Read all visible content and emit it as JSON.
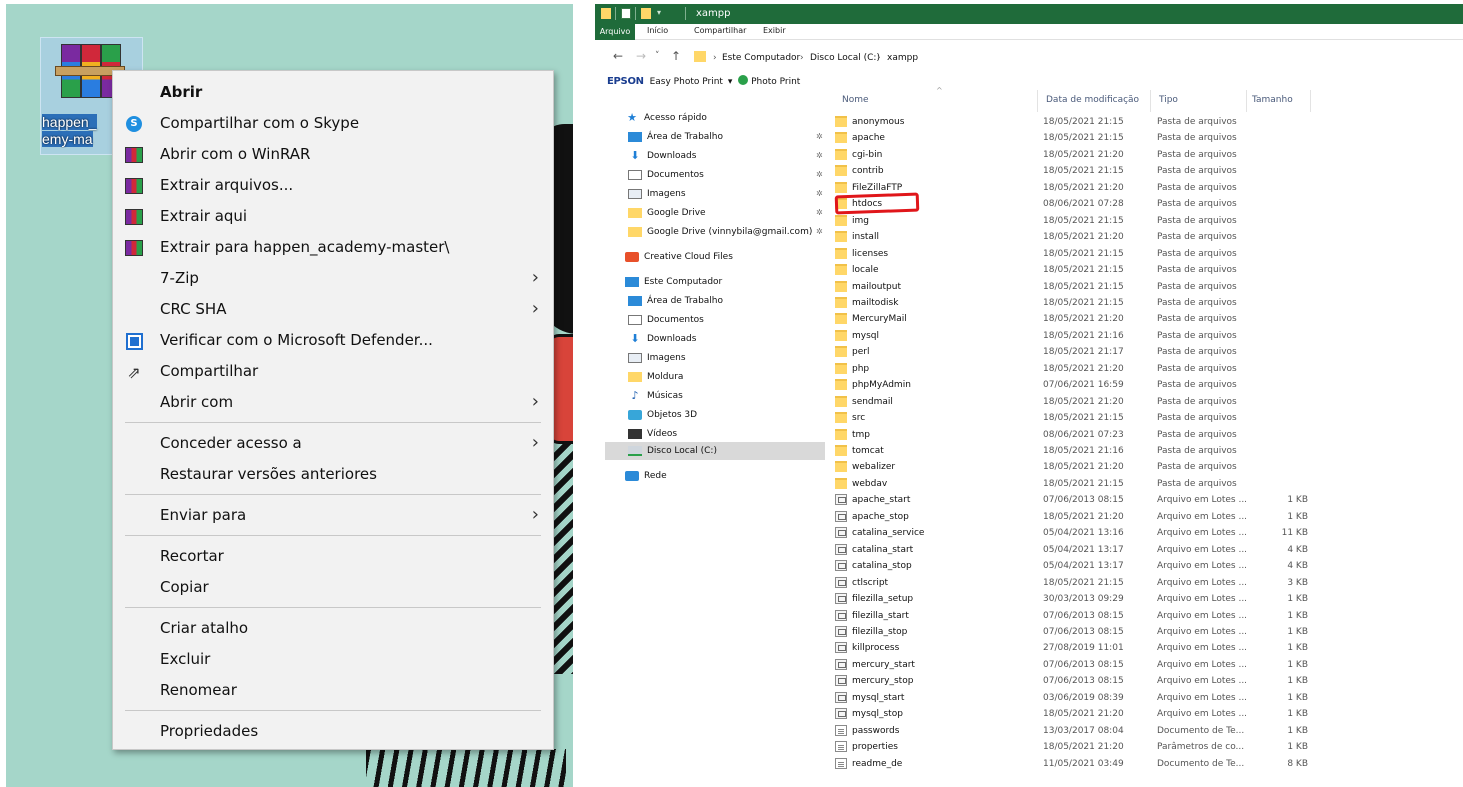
{
  "desktop": {
    "file_icon": {
      "name_line1": "happen_",
      "name_line2": "emy-ma",
      "icon": "winrar-archive-icon"
    }
  },
  "context_menu": {
    "items": [
      {
        "label": "Abrir",
        "bold": true,
        "icon": "",
        "submenu": false
      },
      {
        "label": "Compartilhar com o Skype",
        "icon": "skype-icon",
        "submenu": false
      },
      {
        "label": "Abrir com o WinRAR",
        "icon": "winrar-icon",
        "submenu": false
      },
      {
        "label": "Extrair arquivos...",
        "icon": "winrar-icon",
        "submenu": false
      },
      {
        "label": "Extrair aqui",
        "icon": "winrar-icon",
        "submenu": false
      },
      {
        "label": "Extrair para happen_academy-master\\",
        "icon": "winrar-icon",
        "submenu": false
      },
      {
        "label": "7-Zip",
        "icon": "",
        "submenu": true
      },
      {
        "label": "CRC SHA",
        "icon": "",
        "submenu": true
      },
      {
        "label": "Verificar com o Microsoft Defender...",
        "icon": "defender-icon",
        "submenu": false
      },
      {
        "label": "Compartilhar",
        "icon": "share-icon",
        "submenu": false
      },
      {
        "label": "Abrir com",
        "icon": "",
        "submenu": true
      },
      {
        "separator": true
      },
      {
        "label": "Conceder acesso a",
        "icon": "",
        "submenu": true
      },
      {
        "label": "Restaurar versões anteriores",
        "icon": "",
        "submenu": false
      },
      {
        "separator": true
      },
      {
        "label": "Enviar para",
        "icon": "",
        "submenu": true
      },
      {
        "separator": true
      },
      {
        "label": "Recortar",
        "icon": "",
        "submenu": false
      },
      {
        "label": "Copiar",
        "icon": "",
        "submenu": false
      },
      {
        "separator": true
      },
      {
        "label": "Criar atalho",
        "icon": "",
        "submenu": false
      },
      {
        "label": "Excluir",
        "icon": "",
        "submenu": false
      },
      {
        "label": "Renomear",
        "icon": "",
        "submenu": false
      },
      {
        "separator": true
      },
      {
        "label": "Propriedades",
        "icon": "",
        "submenu": false
      }
    ]
  },
  "explorer": {
    "window_title": "xampp",
    "ribbon_tabs": [
      "Arquivo",
      "Início",
      "Compartilhar",
      "Exibir"
    ],
    "address": {
      "segments": [
        "Este Computador",
        "Disco Local (C:)",
        "xampp"
      ],
      "separator": ">"
    },
    "epson": {
      "logo": "EPSON",
      "easy_photo_print": "Easy Photo Print",
      "dropdown": "▾",
      "photo_print": "Photo Print"
    },
    "nav": [
      {
        "label": "Acesso rápido",
        "icon": "star-icon",
        "level": 0,
        "pin": false
      },
      {
        "label": "Área de Trabalho",
        "icon": "desktop-icon",
        "level": 1,
        "pin": true
      },
      {
        "label": "Downloads",
        "icon": "download-icon",
        "level": 1,
        "pin": true
      },
      {
        "label": "Documentos",
        "icon": "documents-icon",
        "level": 1,
        "pin": true
      },
      {
        "label": "Imagens",
        "icon": "images-icon",
        "level": 1,
        "pin": true
      },
      {
        "label": "Google Drive",
        "icon": "folder-icon",
        "level": 1,
        "pin": true
      },
      {
        "label": "Google Drive (vinnybila@gmail.com)",
        "icon": "folder-icon",
        "level": 1,
        "pin": true
      },
      {
        "label": "Creative Cloud Files",
        "icon": "creative-cloud-icon",
        "level": 0,
        "pin": false
      },
      {
        "label": "Este Computador",
        "icon": "computer-icon",
        "level": 0,
        "pin": false
      },
      {
        "label": "Área de Trabalho",
        "icon": "desktop-icon",
        "level": 1,
        "pin": false
      },
      {
        "label": "Documentos",
        "icon": "documents-icon",
        "level": 1,
        "pin": false
      },
      {
        "label": "Downloads",
        "icon": "download-icon",
        "level": 1,
        "pin": false
      },
      {
        "label": "Imagens",
        "icon": "images-icon",
        "level": 1,
        "pin": false
      },
      {
        "label": "Moldura",
        "icon": "folder-icon",
        "level": 1,
        "pin": false
      },
      {
        "label": "Músicas",
        "icon": "music-icon",
        "level": 1,
        "pin": false
      },
      {
        "label": "Objetos 3D",
        "icon": "3d-objects-icon",
        "level": 1,
        "pin": false
      },
      {
        "label": "Vídeos",
        "icon": "videos-icon",
        "level": 1,
        "pin": false
      },
      {
        "label": "Disco Local (C:)",
        "icon": "drive-icon",
        "level": 1,
        "pin": false,
        "selected": true
      },
      {
        "label": "Rede",
        "icon": "network-icon",
        "level": 0,
        "pin": false
      }
    ],
    "columns": [
      "Nome",
      "Data de modificação",
      "Tipo",
      "Tamanho"
    ],
    "files": [
      {
        "name": "anonymous",
        "date": "18/05/2021 21:15",
        "type": "Pasta de arquivos",
        "size": "",
        "kind": "folder"
      },
      {
        "name": "apache",
        "date": "18/05/2021 21:15",
        "type": "Pasta de arquivos",
        "size": "",
        "kind": "folder"
      },
      {
        "name": "cgi-bin",
        "date": "18/05/2021 21:20",
        "type": "Pasta de arquivos",
        "size": "",
        "kind": "folder"
      },
      {
        "name": "contrib",
        "date": "18/05/2021 21:15",
        "type": "Pasta de arquivos",
        "size": "",
        "kind": "folder"
      },
      {
        "name": "FileZillaFTP",
        "date": "18/05/2021 21:20",
        "type": "Pasta de arquivos",
        "size": "",
        "kind": "folder"
      },
      {
        "name": "htdocs",
        "date": "08/06/2021 07:28",
        "type": "Pasta de arquivos",
        "size": "",
        "kind": "folder"
      },
      {
        "name": "img",
        "date": "18/05/2021 21:15",
        "type": "Pasta de arquivos",
        "size": "",
        "kind": "folder"
      },
      {
        "name": "install",
        "date": "18/05/2021 21:20",
        "type": "Pasta de arquivos",
        "size": "",
        "kind": "folder"
      },
      {
        "name": "licenses",
        "date": "18/05/2021 21:15",
        "type": "Pasta de arquivos",
        "size": "",
        "kind": "folder"
      },
      {
        "name": "locale",
        "date": "18/05/2021 21:15",
        "type": "Pasta de arquivos",
        "size": "",
        "kind": "folder"
      },
      {
        "name": "mailoutput",
        "date": "18/05/2021 21:15",
        "type": "Pasta de arquivos",
        "size": "",
        "kind": "folder"
      },
      {
        "name": "mailtodisk",
        "date": "18/05/2021 21:15",
        "type": "Pasta de arquivos",
        "size": "",
        "kind": "folder"
      },
      {
        "name": "MercuryMail",
        "date": "18/05/2021 21:20",
        "type": "Pasta de arquivos",
        "size": "",
        "kind": "folder"
      },
      {
        "name": "mysql",
        "date": "18/05/2021 21:16",
        "type": "Pasta de arquivos",
        "size": "",
        "kind": "folder"
      },
      {
        "name": "perl",
        "date": "18/05/2021 21:17",
        "type": "Pasta de arquivos",
        "size": "",
        "kind": "folder"
      },
      {
        "name": "php",
        "date": "18/05/2021 21:20",
        "type": "Pasta de arquivos",
        "size": "",
        "kind": "folder"
      },
      {
        "name": "phpMyAdmin",
        "date": "07/06/2021 16:59",
        "type": "Pasta de arquivos",
        "size": "",
        "kind": "folder"
      },
      {
        "name": "sendmail",
        "date": "18/05/2021 21:20",
        "type": "Pasta de arquivos",
        "size": "",
        "kind": "folder"
      },
      {
        "name": "src",
        "date": "18/05/2021 21:15",
        "type": "Pasta de arquivos",
        "size": "",
        "kind": "folder"
      },
      {
        "name": "tmp",
        "date": "08/06/2021 07:23",
        "type": "Pasta de arquivos",
        "size": "",
        "kind": "folder"
      },
      {
        "name": "tomcat",
        "date": "18/05/2021 21:16",
        "type": "Pasta de arquivos",
        "size": "",
        "kind": "folder"
      },
      {
        "name": "webalizer",
        "date": "18/05/2021 21:20",
        "type": "Pasta de arquivos",
        "size": "",
        "kind": "folder"
      },
      {
        "name": "webdav",
        "date": "18/05/2021 21:15",
        "type": "Pasta de arquivos",
        "size": "",
        "kind": "folder"
      },
      {
        "name": "apache_start",
        "date": "07/06/2013 08:15",
        "type": "Arquivo em Lotes ...",
        "size": "1 KB",
        "kind": "bat"
      },
      {
        "name": "apache_stop",
        "date": "18/05/2021 21:20",
        "type": "Arquivo em Lotes ...",
        "size": "1 KB",
        "kind": "bat"
      },
      {
        "name": "catalina_service",
        "date": "05/04/2021 13:16",
        "type": "Arquivo em Lotes ...",
        "size": "11 KB",
        "kind": "bat"
      },
      {
        "name": "catalina_start",
        "date": "05/04/2021 13:17",
        "type": "Arquivo em Lotes ...",
        "size": "4 KB",
        "kind": "bat"
      },
      {
        "name": "catalina_stop",
        "date": "05/04/2021 13:17",
        "type": "Arquivo em Lotes ...",
        "size": "4 KB",
        "kind": "bat"
      },
      {
        "name": "ctlscript",
        "date": "18/05/2021 21:15",
        "type": "Arquivo em Lotes ...",
        "size": "3 KB",
        "kind": "bat"
      },
      {
        "name": "filezilla_setup",
        "date": "30/03/2013 09:29",
        "type": "Arquivo em Lotes ...",
        "size": "1 KB",
        "kind": "bat"
      },
      {
        "name": "filezilla_start",
        "date": "07/06/2013 08:15",
        "type": "Arquivo em Lotes ...",
        "size": "1 KB",
        "kind": "bat"
      },
      {
        "name": "filezilla_stop",
        "date": "07/06/2013 08:15",
        "type": "Arquivo em Lotes ...",
        "size": "1 KB",
        "kind": "bat"
      },
      {
        "name": "killprocess",
        "date": "27/08/2019 11:01",
        "type": "Arquivo em Lotes ...",
        "size": "1 KB",
        "kind": "bat"
      },
      {
        "name": "mercury_start",
        "date": "07/06/2013 08:15",
        "type": "Arquivo em Lotes ...",
        "size": "1 KB",
        "kind": "bat"
      },
      {
        "name": "mercury_stop",
        "date": "07/06/2013 08:15",
        "type": "Arquivo em Lotes ...",
        "size": "1 KB",
        "kind": "bat"
      },
      {
        "name": "mysql_start",
        "date": "03/06/2019 08:39",
        "type": "Arquivo em Lotes ...",
        "size": "1 KB",
        "kind": "bat"
      },
      {
        "name": "mysql_stop",
        "date": "18/05/2021 21:20",
        "type": "Arquivo em Lotes ...",
        "size": "1 KB",
        "kind": "bat"
      },
      {
        "name": "passwords",
        "date": "13/03/2017 08:04",
        "type": "Documento de Te...",
        "size": "1 KB",
        "kind": "txt"
      },
      {
        "name": "properties",
        "date": "18/05/2021 21:20",
        "type": "Parâmetros de co...",
        "size": "1 KB",
        "kind": "ini"
      },
      {
        "name": "readme_de",
        "date": "11/05/2021 03:49",
        "type": "Documento de Te...",
        "size": "8 KB",
        "kind": "txt"
      }
    ]
  },
  "colors": {
    "titlebar": "#1f6b3a",
    "desktop": "#a5d6c9",
    "highlight": "#e0161a"
  }
}
